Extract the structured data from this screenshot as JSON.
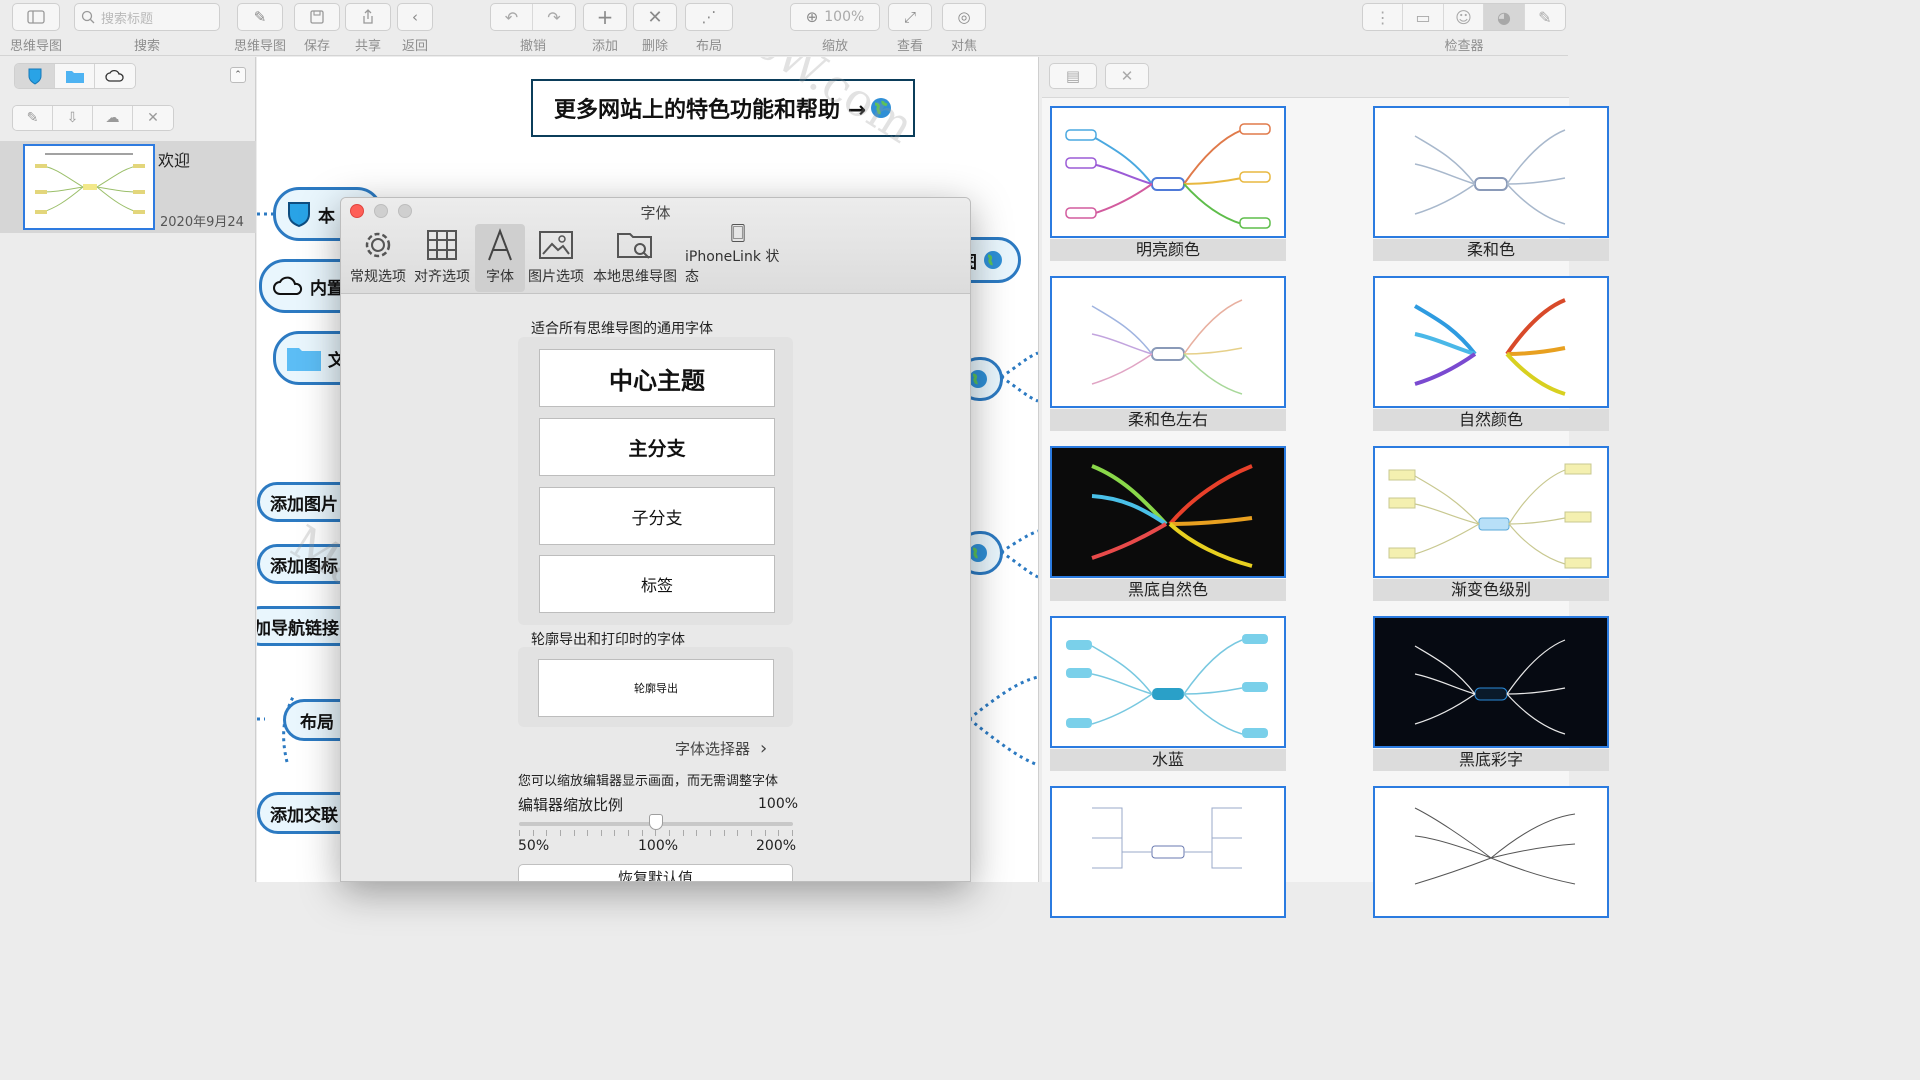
{
  "toolbar": {
    "mindmap_label": "思维导图",
    "search_label": "搜索",
    "search_placeholder": "搜索标题",
    "mindmap2_label": "思维导图",
    "save_label": "保存",
    "share_label": "共享",
    "back_label": "返回",
    "undo_label": "撤销",
    "add_label": "添加",
    "delete_label": "删除",
    "layout_label": "布局",
    "zoom_label": "缩放",
    "zoom_value": "100%",
    "view_label": "查看",
    "focus_label": "对焦",
    "inspector_label": "检查器"
  },
  "sidebar": {
    "doc_title": "欢迎",
    "doc_date": "2020年9月24"
  },
  "canvas": {
    "banner_text": "更多网站上的特色功能和帮助 →",
    "nodes": {
      "n1": "本",
      "n2": "内置",
      "n3": "文",
      "n4": "添加图片",
      "n5": "添加图标",
      "n6": "加导航链接",
      "n7": "布局",
      "n8": "添加交联",
      "n_right": "图"
    },
    "watermark": "MacW.com"
  },
  "dialog": {
    "title": "字体",
    "tabs": [
      "常规选项",
      "对齐选项",
      "字体",
      "图片选项",
      "本地思维导图",
      "iPhoneLink 状态"
    ],
    "section1": "适合所有思维导图的通用字体",
    "fonts": {
      "central": "中心主题",
      "main_branch": "主分支",
      "sub_branch": "子分支",
      "label": "标签"
    },
    "section2": "轮廓导出和打印时的字体",
    "outline_font": "轮廓导出",
    "chooser": "字体选择器",
    "zoom_hint": "您可以缩放编辑器显示画面，而无需调整字体",
    "zoom_title": "编辑器缩放比例",
    "zoom_value": "100%",
    "slider_min": "50%",
    "slider_mid": "100%",
    "slider_max": "200%",
    "slider_level": 0.5,
    "reset": "恢复默认值"
  },
  "inspector": {
    "themes": [
      "明亮颜色",
      "柔和色",
      "柔和色左右",
      "自然颜色",
      "黑底自然色",
      "渐变色级别",
      "水蓝",
      "黑底彩字"
    ]
  },
  "colors": {
    "accent": "#2c7ac2",
    "close": "#fe5f57",
    "disabled": "#cfcfcf"
  }
}
